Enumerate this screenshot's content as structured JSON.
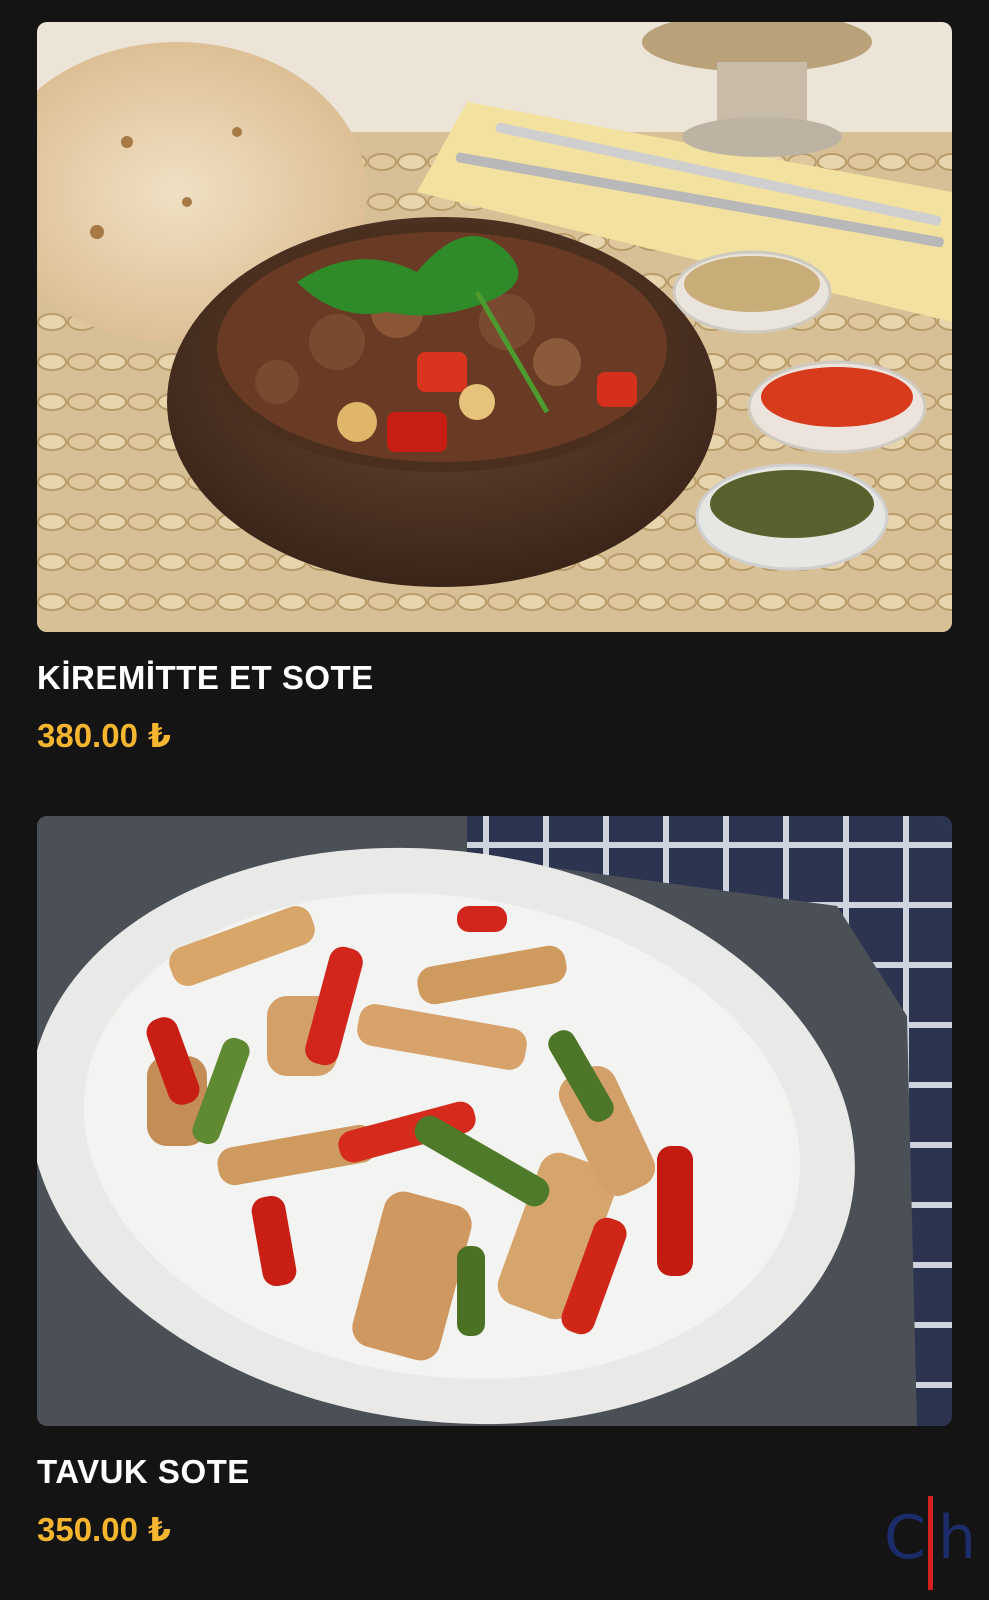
{
  "menu_items": [
    {
      "name": "KİREMİTTE ET SOTE",
      "price": "380.00",
      "currency": "₺",
      "image_icon": "meat-saute-clay-pot-photo"
    },
    {
      "name": "TAVUK SOTE",
      "price": "350.00",
      "currency": "₺",
      "image_icon": "chicken-saute-plate-photo"
    }
  ],
  "brand": {
    "logo_left": "C",
    "logo_right": "h",
    "logo_icon": "brand-logo-icon"
  },
  "colors": {
    "background": "#141414",
    "price": "#f5b52f",
    "name": "#ffffff",
    "logo_blue": "#1c2c6a",
    "logo_red": "#d32020"
  }
}
